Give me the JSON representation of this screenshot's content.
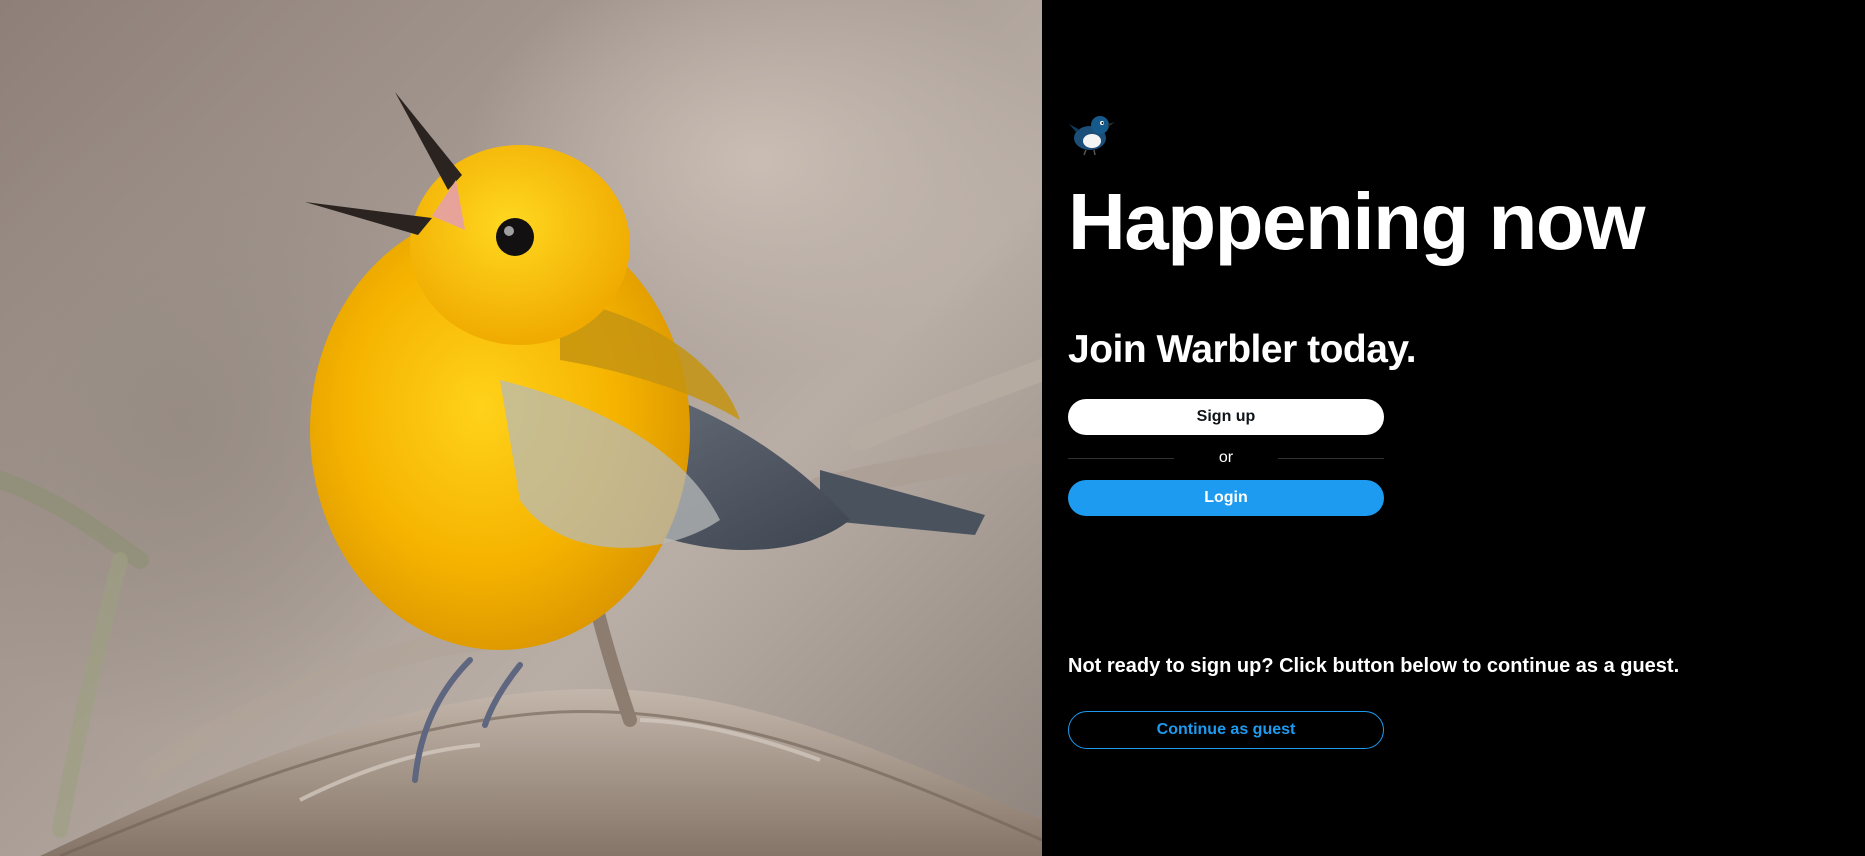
{
  "hero": {
    "icon": "warbler-photo",
    "colors": {
      "bird_yellow": "#f5b800",
      "wing_gray": "#5b6573",
      "branch": "#a79a8e"
    }
  },
  "brand": {
    "logo_icon": "warbler-bird-logo"
  },
  "headline": "Happening now",
  "subhead": "Join Warbler today.",
  "auth": {
    "signup_label": "Sign up",
    "divider_label": "or",
    "login_label": "Login"
  },
  "guest": {
    "prompt": "Not ready to sign up? Click button below to continue as a guest.",
    "button_label": "Continue as guest"
  },
  "colors": {
    "accent": "#1d9bf0",
    "background": "#000000",
    "text": "#ffffff",
    "divider": "#2f3336"
  }
}
